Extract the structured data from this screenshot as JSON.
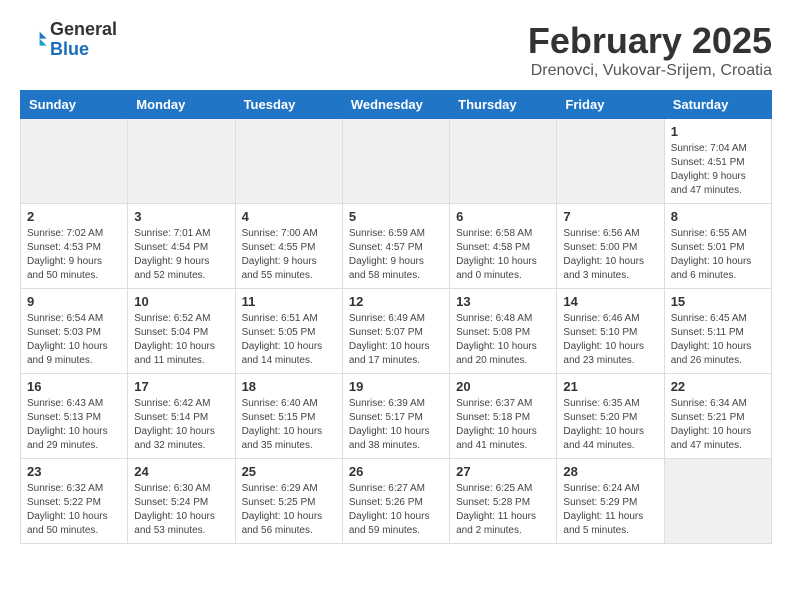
{
  "logo": {
    "general": "General",
    "blue": "Blue"
  },
  "title": "February 2025",
  "location": "Drenovci, Vukovar-Srijem, Croatia",
  "days_header": [
    "Sunday",
    "Monday",
    "Tuesday",
    "Wednesday",
    "Thursday",
    "Friday",
    "Saturday"
  ],
  "weeks": [
    [
      {
        "day": "",
        "info": ""
      },
      {
        "day": "",
        "info": ""
      },
      {
        "day": "",
        "info": ""
      },
      {
        "day": "",
        "info": ""
      },
      {
        "day": "",
        "info": ""
      },
      {
        "day": "",
        "info": ""
      },
      {
        "day": "1",
        "info": "Sunrise: 7:04 AM\nSunset: 4:51 PM\nDaylight: 9 hours and 47 minutes."
      }
    ],
    [
      {
        "day": "2",
        "info": "Sunrise: 7:02 AM\nSunset: 4:53 PM\nDaylight: 9 hours and 50 minutes."
      },
      {
        "day": "3",
        "info": "Sunrise: 7:01 AM\nSunset: 4:54 PM\nDaylight: 9 hours and 52 minutes."
      },
      {
        "day": "4",
        "info": "Sunrise: 7:00 AM\nSunset: 4:55 PM\nDaylight: 9 hours and 55 minutes."
      },
      {
        "day": "5",
        "info": "Sunrise: 6:59 AM\nSunset: 4:57 PM\nDaylight: 9 hours and 58 minutes."
      },
      {
        "day": "6",
        "info": "Sunrise: 6:58 AM\nSunset: 4:58 PM\nDaylight: 10 hours and 0 minutes."
      },
      {
        "day": "7",
        "info": "Sunrise: 6:56 AM\nSunset: 5:00 PM\nDaylight: 10 hours and 3 minutes."
      },
      {
        "day": "8",
        "info": "Sunrise: 6:55 AM\nSunset: 5:01 PM\nDaylight: 10 hours and 6 minutes."
      }
    ],
    [
      {
        "day": "9",
        "info": "Sunrise: 6:54 AM\nSunset: 5:03 PM\nDaylight: 10 hours and 9 minutes."
      },
      {
        "day": "10",
        "info": "Sunrise: 6:52 AM\nSunset: 5:04 PM\nDaylight: 10 hours and 11 minutes."
      },
      {
        "day": "11",
        "info": "Sunrise: 6:51 AM\nSunset: 5:05 PM\nDaylight: 10 hours and 14 minutes."
      },
      {
        "day": "12",
        "info": "Sunrise: 6:49 AM\nSunset: 5:07 PM\nDaylight: 10 hours and 17 minutes."
      },
      {
        "day": "13",
        "info": "Sunrise: 6:48 AM\nSunset: 5:08 PM\nDaylight: 10 hours and 20 minutes."
      },
      {
        "day": "14",
        "info": "Sunrise: 6:46 AM\nSunset: 5:10 PM\nDaylight: 10 hours and 23 minutes."
      },
      {
        "day": "15",
        "info": "Sunrise: 6:45 AM\nSunset: 5:11 PM\nDaylight: 10 hours and 26 minutes."
      }
    ],
    [
      {
        "day": "16",
        "info": "Sunrise: 6:43 AM\nSunset: 5:13 PM\nDaylight: 10 hours and 29 minutes."
      },
      {
        "day": "17",
        "info": "Sunrise: 6:42 AM\nSunset: 5:14 PM\nDaylight: 10 hours and 32 minutes."
      },
      {
        "day": "18",
        "info": "Sunrise: 6:40 AM\nSunset: 5:15 PM\nDaylight: 10 hours and 35 minutes."
      },
      {
        "day": "19",
        "info": "Sunrise: 6:39 AM\nSunset: 5:17 PM\nDaylight: 10 hours and 38 minutes."
      },
      {
        "day": "20",
        "info": "Sunrise: 6:37 AM\nSunset: 5:18 PM\nDaylight: 10 hours and 41 minutes."
      },
      {
        "day": "21",
        "info": "Sunrise: 6:35 AM\nSunset: 5:20 PM\nDaylight: 10 hours and 44 minutes."
      },
      {
        "day": "22",
        "info": "Sunrise: 6:34 AM\nSunset: 5:21 PM\nDaylight: 10 hours and 47 minutes."
      }
    ],
    [
      {
        "day": "23",
        "info": "Sunrise: 6:32 AM\nSunset: 5:22 PM\nDaylight: 10 hours and 50 minutes."
      },
      {
        "day": "24",
        "info": "Sunrise: 6:30 AM\nSunset: 5:24 PM\nDaylight: 10 hours and 53 minutes."
      },
      {
        "day": "25",
        "info": "Sunrise: 6:29 AM\nSunset: 5:25 PM\nDaylight: 10 hours and 56 minutes."
      },
      {
        "day": "26",
        "info": "Sunrise: 6:27 AM\nSunset: 5:26 PM\nDaylight: 10 hours and 59 minutes."
      },
      {
        "day": "27",
        "info": "Sunrise: 6:25 AM\nSunset: 5:28 PM\nDaylight: 11 hours and 2 minutes."
      },
      {
        "day": "28",
        "info": "Sunrise: 6:24 AM\nSunset: 5:29 PM\nDaylight: 11 hours and 5 minutes."
      },
      {
        "day": "",
        "info": ""
      }
    ]
  ]
}
